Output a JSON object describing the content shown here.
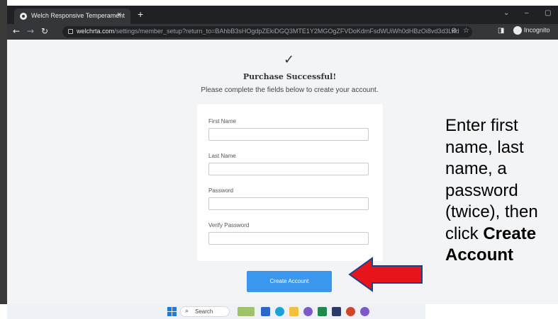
{
  "browser": {
    "tab_title": "Welch Responsive Temperament",
    "tab_close": "×",
    "new_tab": "+",
    "url_host": "welchrta.com",
    "url_path": "/settings/member_setup?return_to=BAhbB3sHOgdpZEkiDGQ3MTE1Y2MGOgZFVDoKdmFsdWUiWh0dHBzOi8vd3d3LndlbGNocnRhLmNvbS...",
    "incognito_label": "Incognito"
  },
  "page": {
    "check_mark": "✓",
    "title": "Purchase Successful!",
    "subtitle": "Please complete the fields below to create your account.",
    "fields": [
      {
        "label": "First Name",
        "value": ""
      },
      {
        "label": "Last Name",
        "value": ""
      },
      {
        "label": "Password",
        "value": ""
      },
      {
        "label": "Verify Password",
        "value": ""
      }
    ],
    "create_button": "Create Account"
  },
  "taskbar": {
    "search_placeholder": "Search"
  },
  "annotation": {
    "text_before": "Enter first name, last name, a password (twice), then click ",
    "text_bold": "Create Account",
    "arrow_color": "#e8141b"
  },
  "colors": {
    "button": "#3b97ed",
    "page_bg": "#f3f4f6",
    "browser_dark": "#202124"
  }
}
